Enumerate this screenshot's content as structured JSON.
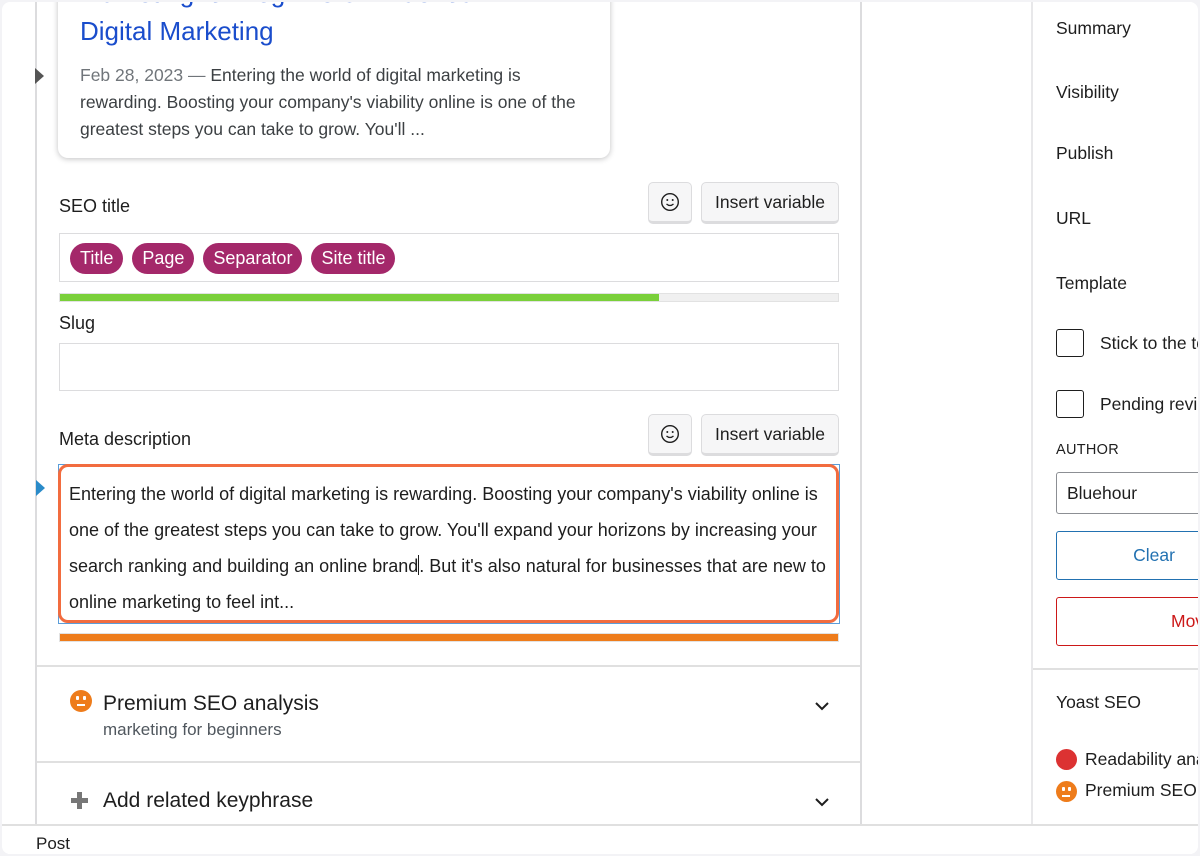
{
  "preview": {
    "title_line1": "Marketing for Beginners - Bluehour",
    "title_line2": "Digital Marketing",
    "date": "Feb 28, 2023",
    "dash": " — ",
    "snippet": "Entering the world of digital marketing is rewarding. Boosting your company's viability online is one of the greatest steps you can take to grow. You'll ..."
  },
  "seo_title": {
    "label": "SEO title",
    "emoji_icon": "smiley-icon",
    "insert_variable_label": "Insert variable",
    "variables": [
      "Title",
      "Page",
      "Separator",
      "Site title"
    ],
    "progress_percent": 77,
    "progress_color": "#7ad03a"
  },
  "slug": {
    "label": "Slug",
    "value": ""
  },
  "meta_description": {
    "label": "Meta description",
    "emoji_icon": "smiley-icon",
    "insert_variable_label": "Insert variable",
    "text_before_caret": "Entering the world of digital marketing is rewarding. Boosting your company's viability online is one of the greatest steps you can take to grow. You'll expand your horizons by increasing your search ranking and building an online brand",
    "text_after_caret": ". But it's also natural for businesses that are new to online marketing to feel int...",
    "progress_percent": 100,
    "progress_color": "#ee7c1b",
    "focus_border_color": "#f26c3f"
  },
  "sections": [
    {
      "title": "Premium SEO analysis",
      "subtitle": "marketing for beginners",
      "icon": "neutral-face-icon",
      "status_color": "#ee7c1b"
    },
    {
      "title": "Add related keyphrase",
      "icon": "plus-icon"
    }
  ],
  "bottom_bar": {
    "label": "Post"
  },
  "sidebar": {
    "summary_label": "Summary",
    "rows": [
      "Visibility",
      "Publish",
      "URL",
      "Template"
    ],
    "checkboxes": [
      {
        "label": "Stick to the top of the blog",
        "checked": false
      },
      {
        "label": "Pending review",
        "checked": false
      }
    ],
    "author_label": "AUTHOR",
    "author_value": "Bluehour",
    "clear_button": "Clear",
    "move_button": "Move to trash",
    "yoast_title": "Yoast SEO",
    "yoast_items": [
      {
        "label": "Readability analysis",
        "status": "bad",
        "color": "#dc3232"
      },
      {
        "label": "Premium SEO analysis",
        "status": "ok",
        "color": "#ee7c1b"
      }
    ]
  }
}
